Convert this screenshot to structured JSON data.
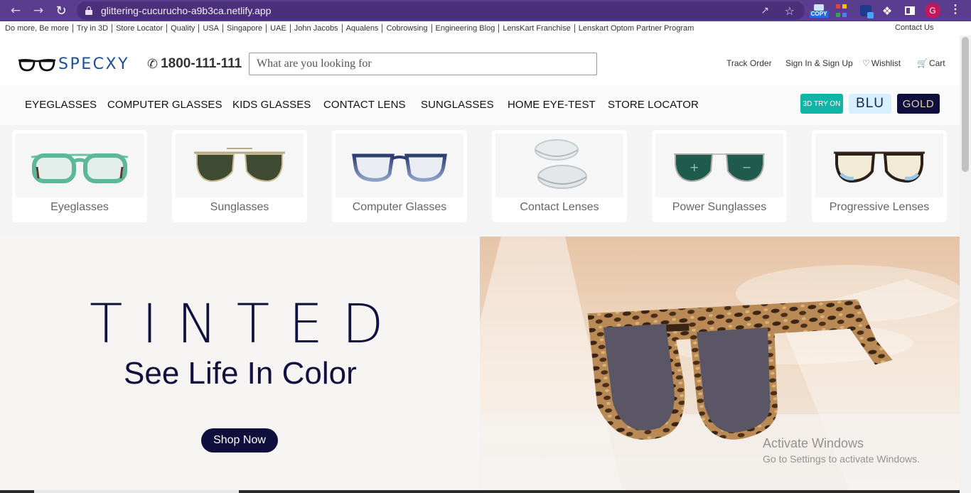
{
  "browser": {
    "url": "glittering-cucurucho-a9b3ca.netlify.app",
    "copy_ext_label": "COPY",
    "profile_initial": "G"
  },
  "toplinks": [
    "Do more, Be more",
    "Try in 3D",
    "Store Locator",
    "Quality",
    "USA",
    "Singapore",
    "UAE",
    "John Jacobs",
    "Aqualens",
    "Cobrowsing",
    "Engineering Blog",
    "LensKart Franchise",
    "Lenskart Optom Partner Program"
  ],
  "contact_us": "Contact Us",
  "header": {
    "logo_text": "SPECXY",
    "phone": "1800-111-111",
    "search_placeholder": "What are you looking for",
    "track_order": "Track Order",
    "sign_in": "Sign In & Sign Up",
    "wishlist": "Wishlist",
    "cart": "Cart"
  },
  "nav": {
    "items": [
      "EYEGLASSES",
      "COMPUTER GLASSES",
      "KIDS GLASSES",
      "CONTACT LENS",
      "SUNGLASSES",
      "HOME EYE-TEST",
      "STORE LOCATOR"
    ],
    "badge_3d": "3D TRY ON",
    "badge_blu": "BLU",
    "badge_gold": "GOLD"
  },
  "tiles": [
    {
      "label": "Eyeglasses",
      "icon": "green-eyeglasses-image"
    },
    {
      "label": "Sunglasses",
      "icon": "aviator-sunglasses-image"
    },
    {
      "label": "Computer Glasses",
      "icon": "computer-glasses-image"
    },
    {
      "label": "Contact Lenses",
      "icon": "contact-lenses-image"
    },
    {
      "label": "Power Sunglasses",
      "icon": "power-sunglasses-image"
    },
    {
      "label": "Progressive Lenses",
      "icon": "progressive-lenses-image"
    }
  ],
  "hero": {
    "title": "TINTED",
    "subtitle": "See Life In Color",
    "cta": "Shop Now"
  },
  "watermark": {
    "line1": "Activate Windows",
    "line2": "Go to Settings to activate Windows."
  },
  "colors": {
    "chrome": "#5a3d8f",
    "navy": "#0f0e3c",
    "teal": "#11b5a8",
    "logo_blue": "#1d4f9c"
  }
}
